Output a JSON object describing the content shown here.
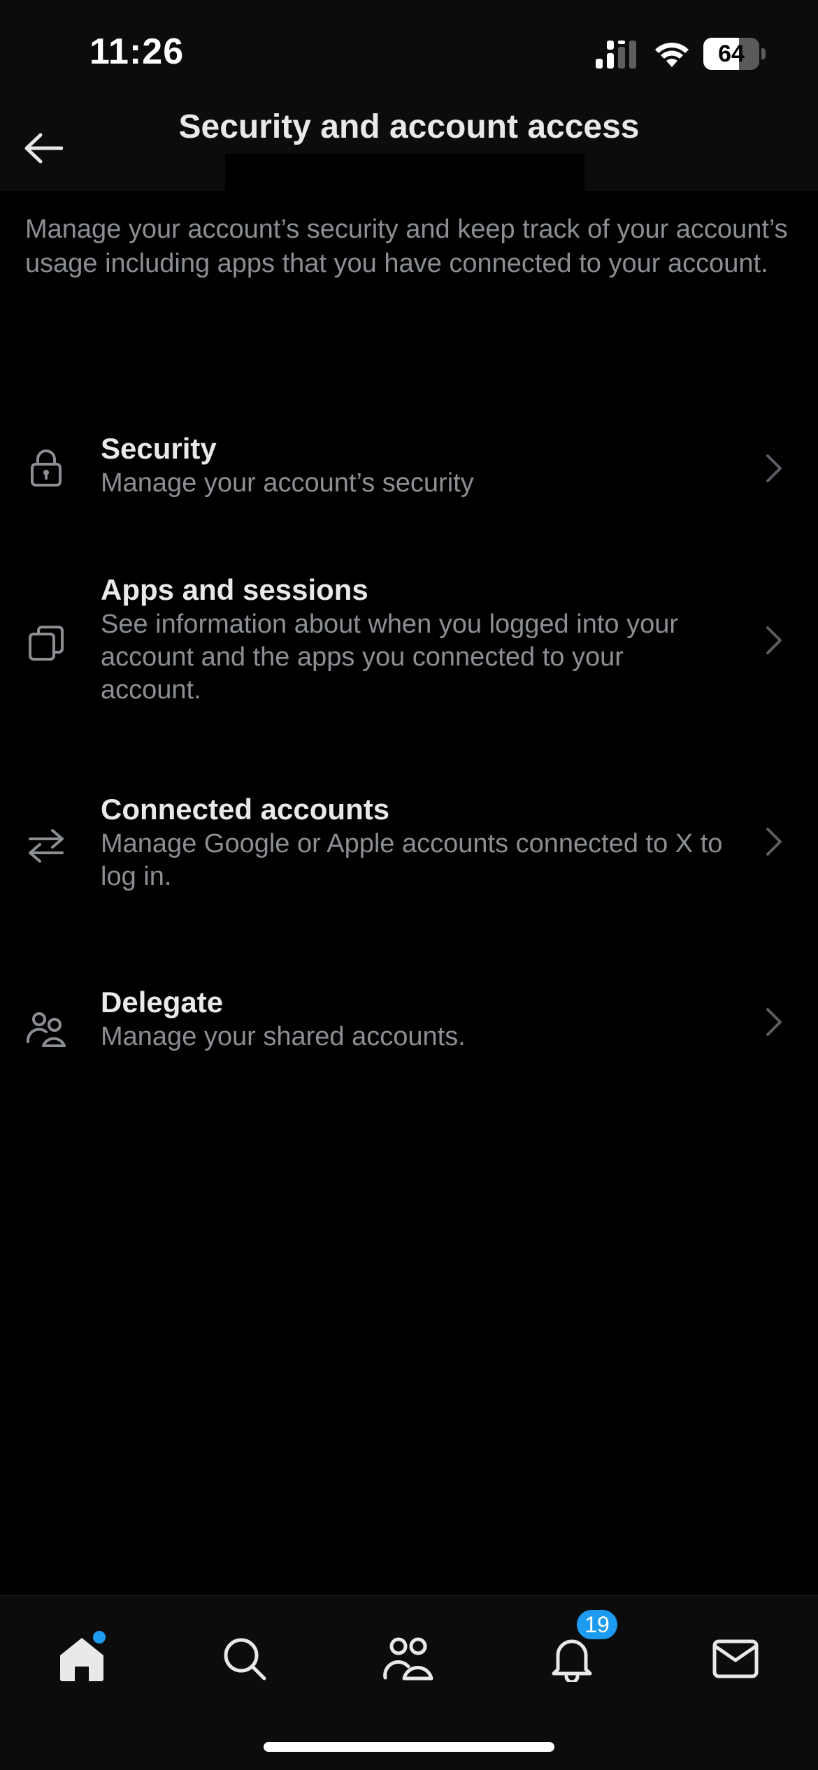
{
  "status_bar": {
    "time": "11:26",
    "battery_level": "64",
    "battery_fraction": 0.64
  },
  "header": {
    "back_icon": "arrow-left-icon",
    "title": "Security and account access"
  },
  "description": "Manage your account’s security and keep track of your account’s usage including apps that you have connected to your account.",
  "items": [
    {
      "icon": "lock-icon",
      "title": "Security",
      "subtitle": "Manage your account’s security"
    },
    {
      "icon": "copy-windows-icon",
      "title": "Apps and sessions",
      "subtitle": "See information about when you logged into your account and the apps you connected to your account."
    },
    {
      "icon": "swap-arrows-icon",
      "title": "Connected accounts",
      "subtitle": "Manage Google or Apple accounts connected to X to log in."
    },
    {
      "icon": "people-icon",
      "title": "Delegate",
      "subtitle": "Manage your shared accounts."
    }
  ],
  "tab_bar": {
    "tabs": [
      {
        "icon": "home-icon",
        "active": true,
        "has_dot": true
      },
      {
        "icon": "search-icon",
        "active": false
      },
      {
        "icon": "communities-icon",
        "active": false
      },
      {
        "icon": "bell-icon",
        "active": false
      },
      {
        "icon": "mail-icon",
        "active": false
      }
    ],
    "notifications_badge": "19"
  },
  "colors": {
    "accent": "#1d9bf0",
    "background": "#000000",
    "chrome": "#0c0c0c",
    "primary_text": "#e7e9ea",
    "secondary_text": "#8b8f94"
  }
}
